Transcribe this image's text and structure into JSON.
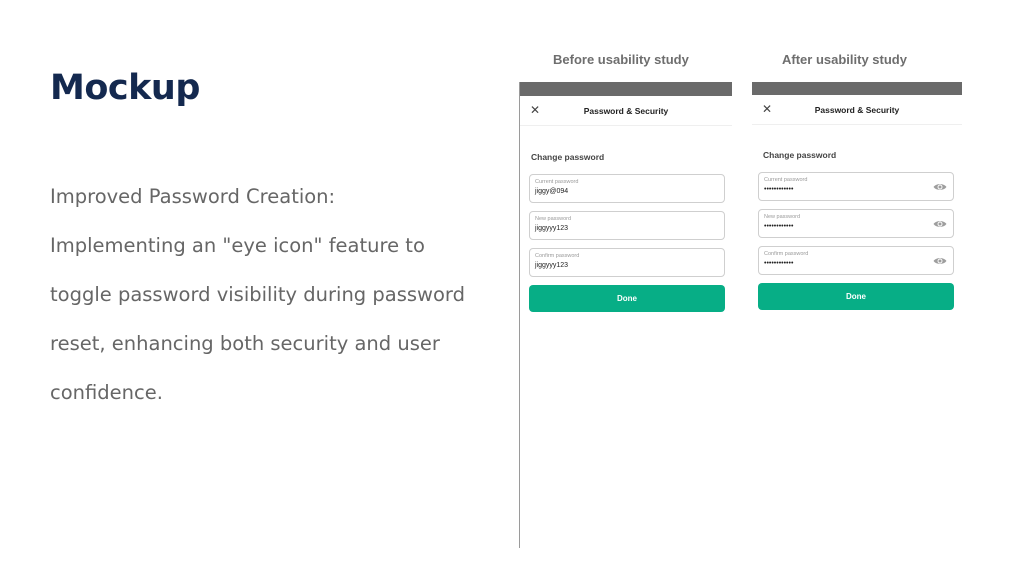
{
  "slide": {
    "title": "Mockup",
    "body_lines": [
      "Improved Password Creation:",
      "Implementing an \"eye icon\" feature to",
      "toggle password visibility during password",
      "reset, enhancing both security and user",
      "confidence."
    ]
  },
  "before": {
    "label": "Before usability study",
    "nav_title": "Password & Security",
    "close_icon": "close-icon",
    "section_title": "Change password",
    "fields": [
      {
        "label": "Current password",
        "value": "jiggy@094"
      },
      {
        "label": "New password",
        "value": "jiggyyy123"
      },
      {
        "label": "Confirm password",
        "value": "jiggyyy123"
      }
    ],
    "done_label": "Done"
  },
  "after": {
    "label": "After usability study",
    "nav_title": "Password & Security",
    "close_icon": "close-icon",
    "section_title": "Change password",
    "fields": [
      {
        "label": "Current password",
        "value": "••••••••••••",
        "icon": "eye-icon"
      },
      {
        "label": "New password",
        "value": "••••••••••••",
        "icon": "eye-icon"
      },
      {
        "label": "Confirm password",
        "value": "••••••••••••",
        "icon": "eye-icon"
      }
    ],
    "done_label": "Done"
  },
  "colors": {
    "title": "#14294f",
    "body_text": "#666666",
    "accent_button": "#07ae86",
    "status_bar": "#6a6a6a"
  }
}
